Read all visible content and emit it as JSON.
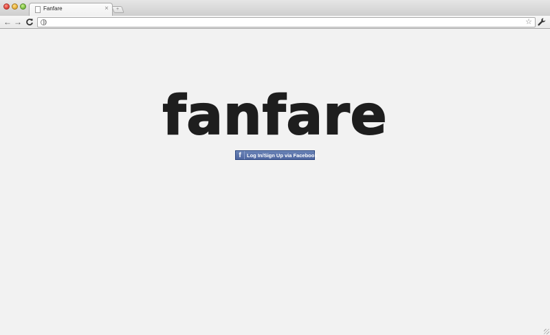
{
  "browser": {
    "tab_title": "Fanfare",
    "new_tab_label": "+",
    "close_tab_glyph": "×",
    "address": "",
    "nav": {
      "back_glyph": "←",
      "forward_glyph": "→",
      "reload_glyph": "C",
      "star_glyph": "☆"
    },
    "icons": [
      "close-window-icon",
      "minimize-window-icon",
      "maximize-window-icon",
      "page-icon",
      "globe-icon",
      "star-icon",
      "wrench-icon"
    ]
  },
  "page": {
    "logo_text": "fanfare",
    "facebook_button": {
      "icon_letter": "f",
      "label": "Log In/Sign Up via Facebook"
    }
  },
  "colors": {
    "page_background": "#f2f2f2",
    "logo": "#1e1e1e",
    "facebook_blue": "#5872a7"
  }
}
